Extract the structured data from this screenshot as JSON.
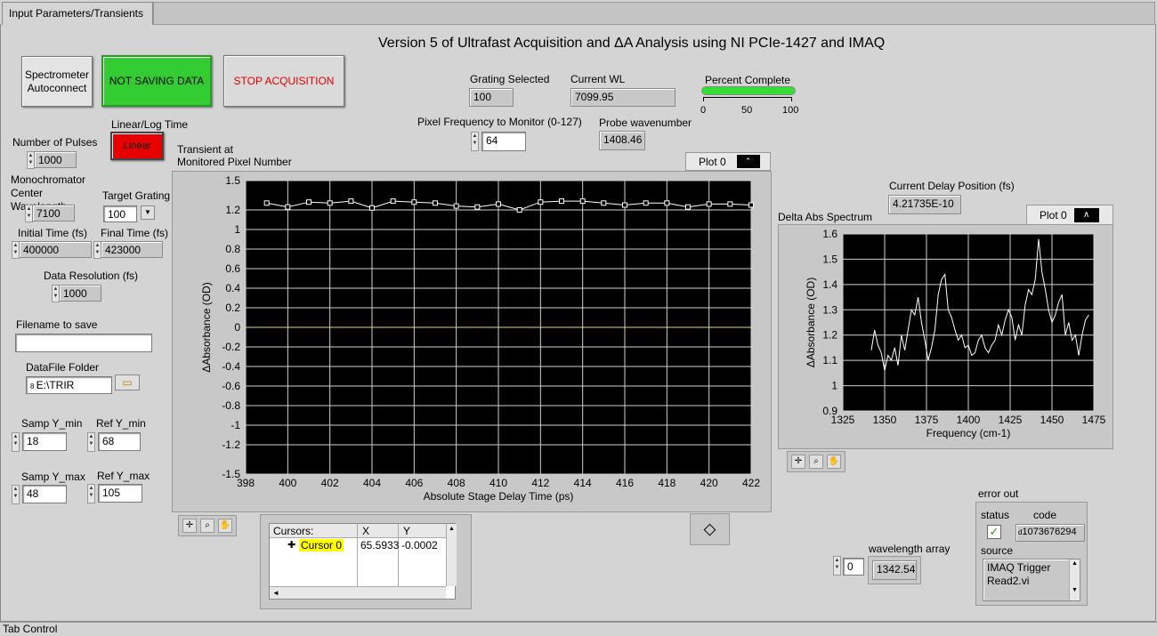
{
  "tab": {
    "label": "Input Parameters/Transients",
    "control_label": "Tab Control"
  },
  "title": "Version 5 of Ultrafast Acquisition and ΔA Analysis using NI PCIe-1427 and IMAQ",
  "buttons": {
    "spectrometer": "Spectrometer Autoconnect",
    "saving": "NOT SAVING DATA",
    "stop": "STOP ACQUISITION",
    "linear_log_label": "Linear/Log Time",
    "linear": "Linear"
  },
  "params": {
    "pulses_label": "Number of Pulses",
    "pulses": "1000",
    "mono_label": "Monochromator Center Wavelength",
    "mono": "7100",
    "target_grating_label": "Target Grating",
    "target_grating": "100",
    "initial_time_label": "Initial Time (fs)",
    "initial_time": "400000",
    "final_time_label": "Final Time (fs)",
    "final_time": "423000",
    "resolution_label": "Data Resolution (fs)",
    "resolution": "1000",
    "filename_label": "Filename to save",
    "filename": "",
    "folder_label": "DataFile Folder",
    "folder": "E:\\TRIR",
    "samp_ymin_label": "Samp Y_min",
    "samp_ymin": "18",
    "ref_ymin_label": "Ref Y_min",
    "ref_ymin": "68",
    "samp_ymax_label": "Samp Y_max",
    "samp_ymax": "48",
    "ref_ymax_label": "Ref Y_max",
    "ref_ymax": "105"
  },
  "status": {
    "grating_label": "Grating Selected",
    "grating": "100",
    "wl_label": "Current WL",
    "wl": "7099.95",
    "percent_label": "Percent Complete",
    "percent": 1.0,
    "percent_ticks": [
      "0",
      "50",
      "100"
    ],
    "pixel_label": "Pixel Frequency to Monitor (0-127)",
    "pixel": "64",
    "probe_label": "Probe wavenumber",
    "probe": "1408.46",
    "delay_label": "Current Delay Position (fs)",
    "delay": "4.21735E-10"
  },
  "transient": {
    "caption": "Transient at\nMonitored Pixel Number",
    "legend": "Plot 0",
    "cursors": {
      "h_name": "Cursors:",
      "h_x": "X",
      "h_y": "Y",
      "name": "Cursor 0",
      "x": "65.5933",
      "y": "-0.0002"
    }
  },
  "spectrum": {
    "caption": "Delta Abs Spectrum",
    "legend": "Plot 0"
  },
  "error": {
    "title": "error out",
    "status_label": "status",
    "code_label": "code",
    "code": "1073676294",
    "source_label": "source",
    "source": "IMAQ Trigger Read2.vi"
  },
  "wavelength": {
    "label": "wavelength array",
    "index": "0",
    "value": "1342.54"
  },
  "colors": {
    "green": "#33cc33",
    "red": "#e60000",
    "trace": "#ffffff",
    "zero": "#e8d870"
  },
  "chart_data": [
    {
      "type": "line",
      "xlabel": "Absolute Stage Delay Time (ps)",
      "ylabel": "ΔAbsorbance (OD)",
      "xlim": [
        398,
        422
      ],
      "ylim": [
        -1.5,
        1.5
      ],
      "xticks": [
        398,
        400,
        402,
        404,
        406,
        408,
        410,
        412,
        414,
        416,
        418,
        420,
        422
      ],
      "yticks": [
        -1.5,
        -1.2,
        -1,
        -0.8,
        -0.6,
        -0.4,
        -0.2,
        0,
        0.2,
        0.4,
        0.6,
        0.8,
        1,
        1.2,
        1.5
      ],
      "grid": true,
      "series": [
        {
          "name": "Plot 0",
          "x": [
            399,
            400,
            401,
            402,
            403,
            404,
            405,
            406,
            407,
            408,
            409,
            410,
            411,
            412,
            413,
            414,
            415,
            416,
            417,
            418,
            419,
            420,
            421,
            422
          ],
          "y": [
            1.27,
            1.23,
            1.28,
            1.27,
            1.29,
            1.22,
            1.29,
            1.28,
            1.27,
            1.24,
            1.23,
            1.26,
            1.2,
            1.28,
            1.29,
            1.29,
            1.27,
            1.25,
            1.27,
            1.27,
            1.23,
            1.26,
            1.26,
            1.25
          ]
        }
      ]
    },
    {
      "type": "line",
      "xlabel": "Frequency (cm-1)",
      "ylabel": "ΔAbsorbance (OD)",
      "xlim": [
        1325,
        1475
      ],
      "ylim": [
        0.9,
        1.6
      ],
      "xticks": [
        1325,
        1350,
        1375,
        1400,
        1425,
        1450,
        1475
      ],
      "yticks": [
        0.9,
        1,
        1.1,
        1.2,
        1.3,
        1.4,
        1.5,
        1.6
      ],
      "grid": true,
      "series": [
        {
          "name": "Plot 0",
          "x": [
            1342,
            1344,
            1346,
            1348,
            1350,
            1352,
            1354,
            1356,
            1358,
            1360,
            1362,
            1364,
            1366,
            1368,
            1370,
            1372,
            1374,
            1376,
            1378,
            1380,
            1382,
            1384,
            1386,
            1388,
            1390,
            1392,
            1394,
            1396,
            1398,
            1400,
            1402,
            1404,
            1406,
            1408,
            1410,
            1412,
            1414,
            1416,
            1418,
            1420,
            1422,
            1424,
            1426,
            1428,
            1430,
            1432,
            1434,
            1436,
            1438,
            1440,
            1442,
            1444,
            1446,
            1448,
            1450,
            1452,
            1454,
            1456,
            1458,
            1460,
            1462,
            1464,
            1466,
            1468,
            1470,
            1472
          ],
          "y": [
            1.14,
            1.22,
            1.16,
            1.13,
            1.06,
            1.12,
            1.1,
            1.15,
            1.08,
            1.2,
            1.14,
            1.22,
            1.3,
            1.28,
            1.35,
            1.25,
            1.18,
            1.1,
            1.15,
            1.22,
            1.36,
            1.42,
            1.44,
            1.3,
            1.27,
            1.22,
            1.18,
            1.2,
            1.15,
            1.16,
            1.12,
            1.13,
            1.18,
            1.2,
            1.15,
            1.13,
            1.16,
            1.18,
            1.24,
            1.2,
            1.26,
            1.3,
            1.27,
            1.18,
            1.24,
            1.2,
            1.32,
            1.38,
            1.36,
            1.42,
            1.58,
            1.45,
            1.38,
            1.3,
            1.25,
            1.28,
            1.33,
            1.36,
            1.2,
            1.25,
            1.18,
            1.2,
            1.12,
            1.2,
            1.26,
            1.28
          ]
        }
      ]
    }
  ]
}
